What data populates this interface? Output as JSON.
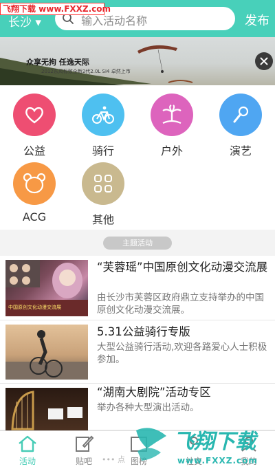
{
  "watermark_top": "飞翔下载 www.FXXZ.com",
  "header": {
    "city": "长沙",
    "search_placeholder": "输入活动名称",
    "publish_label": "发布"
  },
  "banner": {
    "slogan": "众享无拘  任逸天际",
    "subtext": "2012东风标致全新2代2.0L SI4 卓然上市"
  },
  "categories": [
    {
      "label": "公益",
      "icon": "heart-icon",
      "color": "#ee4e72"
    },
    {
      "label": "骑行",
      "icon": "bicycle-icon",
      "color": "#4ec0f0"
    },
    {
      "label": "户外",
      "icon": "palm-tree-icon",
      "color": "#dd64bd"
    },
    {
      "label": "演艺",
      "icon": "microphone-icon",
      "color": "#4fa6f2"
    },
    {
      "label": "ACG",
      "icon": "bear-icon",
      "color": "#f79945"
    },
    {
      "label": "其他",
      "icon": "grid-icon",
      "color": "#c9b98f"
    }
  ],
  "section": {
    "label": "主题活动"
  },
  "activities": [
    {
      "title": "“芙蓉瑶”中国原创文化动漫交流展",
      "desc": "由长沙市芙蓉区政府鼎立支持举办的中国原创文化动漫交流展。",
      "thumb_caption": "中国原创文化动漫交流展"
    },
    {
      "title": "5.31公益骑行专版",
      "desc": "大型公益骑行活动,欢迎各路爱心人士积极参加。"
    },
    {
      "title": "“湖南大剧院”活动专区",
      "desc": "举办各种大型演出活动。"
    }
  ],
  "tabs": [
    {
      "label": "活动",
      "icon": "home-icon",
      "active": true
    },
    {
      "label": "贴吧",
      "icon": "edit-icon",
      "active": false
    },
    {
      "label": "图榜",
      "icon": "chart-icon",
      "active": false
    },
    {
      "label": "社交",
      "icon": "social-icon",
      "active": false
    },
    {
      "label": "我的",
      "icon": "user-icon",
      "active": false
    }
  ],
  "more_text": "••• 点",
  "watermark_bottom": {
    "brand": "飞翔下载",
    "url": "www.FXXZ.com"
  },
  "colors": {
    "header": "#48d0ba",
    "active_tab": "#46ccb6"
  }
}
